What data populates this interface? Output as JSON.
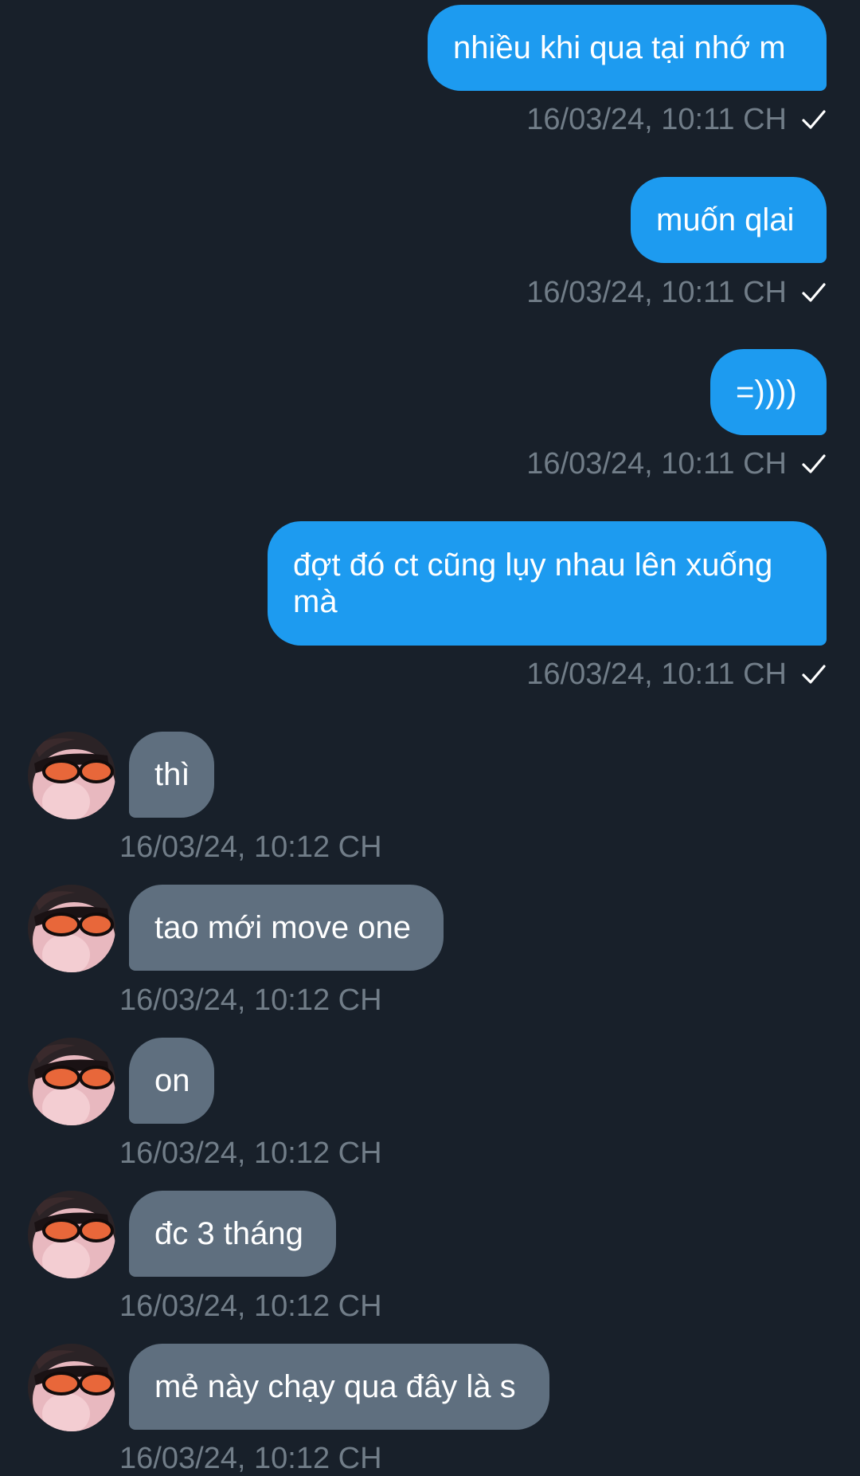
{
  "sent_messages": [
    {
      "text": "nhiều khi qua tại nhớ m",
      "timestamp": "16/03/24, 10:11 CH",
      "status_icon": "check-icon"
    },
    {
      "text": "muốn qlai",
      "timestamp": "16/03/24, 10:11 CH",
      "status_icon": "check-icon"
    },
    {
      "text": "=))))",
      "timestamp": "16/03/24, 10:11 CH",
      "status_icon": "check-icon"
    },
    {
      "text": "đợt đó ct cũng lụy nhau lên xuống mà",
      "timestamp": "16/03/24, 10:11 CH",
      "status_icon": "check-icon"
    }
  ],
  "received_messages": [
    {
      "text": "thì",
      "timestamp": "16/03/24, 10:12 CH"
    },
    {
      "text": "tao mới move one",
      "timestamp": "16/03/24, 10:12 CH"
    },
    {
      "text": "on",
      "timestamp": "16/03/24, 10:12 CH"
    },
    {
      "text": "đc 3 tháng",
      "timestamp": "16/03/24, 10:12 CH"
    },
    {
      "text": "mẻ này chạy qua đây là s",
      "timestamp": "16/03/24, 10:12 CH"
    }
  ],
  "colors": {
    "background": "#18202a",
    "sent_bubble": "#1d9bf0",
    "received_bubble": "#5f6f7f",
    "timestamp": "#717d88"
  }
}
